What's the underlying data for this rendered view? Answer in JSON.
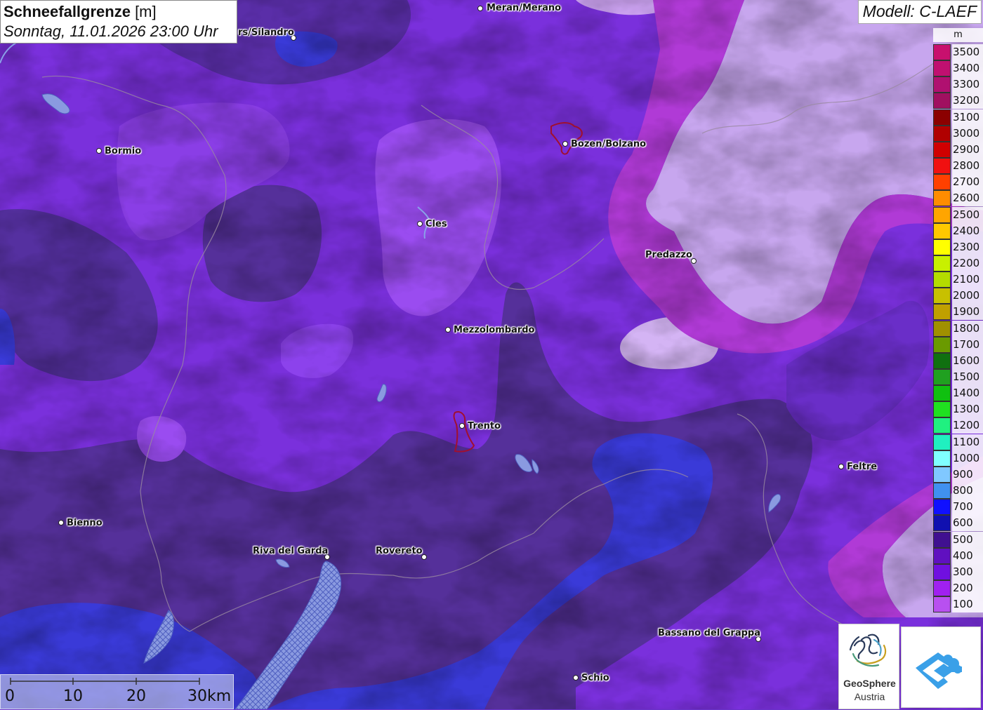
{
  "header": {
    "title_bold": "Schneefallgrenze",
    "title_unit": " [m]",
    "subtitle": "Sonntag, 11.01.2026 23:00 Uhr"
  },
  "model": "Modell: C-LAEF",
  "legend": {
    "unit": "m",
    "entries": [
      {
        "label": "3500",
        "color": "#c8106e"
      },
      {
        "label": "3400",
        "color": "#c01070"
      },
      {
        "label": "3300",
        "color": "#b01070"
      },
      {
        "label": "3200",
        "color": "#a01060"
      },
      {
        "label": "3100",
        "color": "#8b0000"
      },
      {
        "label": "3000",
        "color": "#b00000"
      },
      {
        "label": "2900",
        "color": "#d00000"
      },
      {
        "label": "2800",
        "color": "#f01010"
      },
      {
        "label": "2700",
        "color": "#ff4000"
      },
      {
        "label": "2600",
        "color": "#ff8c00"
      },
      {
        "label": "2500",
        "color": "#ffa500"
      },
      {
        "label": "2400",
        "color": "#ffc800"
      },
      {
        "label": "2300",
        "color": "#ffff00"
      },
      {
        "label": "2200",
        "color": "#c8f000"
      },
      {
        "label": "2100",
        "color": "#b4dc00"
      },
      {
        "label": "2000",
        "color": "#c8c000"
      },
      {
        "label": "1900",
        "color": "#c0a000"
      },
      {
        "label": "1800",
        "color": "#a09000"
      },
      {
        "label": "1700",
        "color": "#6a9a00"
      },
      {
        "label": "1600",
        "color": "#107010"
      },
      {
        "label": "1500",
        "color": "#20a020"
      },
      {
        "label": "1400",
        "color": "#10c010"
      },
      {
        "label": "1300",
        "color": "#20e020"
      },
      {
        "label": "1200",
        "color": "#20f080"
      },
      {
        "label": "1100",
        "color": "#20f0c0"
      },
      {
        "label": "1000",
        "color": "#80ffff"
      },
      {
        "label": "900",
        "color": "#80c8ff"
      },
      {
        "label": "800",
        "color": "#4090f0"
      },
      {
        "label": "700",
        "color": "#1010ff"
      },
      {
        "label": "600",
        "color": "#1010b0"
      },
      {
        "label": "500",
        "color": "#401090"
      },
      {
        "label": "400",
        "color": "#6010c0"
      },
      {
        "label": "300",
        "color": "#7010e0"
      },
      {
        "label": "200",
        "color": "#a020f0"
      },
      {
        "label": "100",
        "color": "#b850f0"
      }
    ]
  },
  "cities": [
    {
      "name": "Meran/Merano"
    },
    {
      "name": "rs/Silandro"
    },
    {
      "name": "Bormio"
    },
    {
      "name": "Bozen/Bolzano"
    },
    {
      "name": "Cles"
    },
    {
      "name": "Predazzo"
    },
    {
      "name": "Mezzolombardo"
    },
    {
      "name": "Trento"
    },
    {
      "name": "Feltre"
    },
    {
      "name": "Bienno"
    },
    {
      "name": "Riva del Garda"
    },
    {
      "name": "Rovereto"
    },
    {
      "name": "Bassano del Grappa"
    },
    {
      "name": "Schio"
    }
  ],
  "scalebar": {
    "labels": [
      "0",
      "10",
      "20",
      "30km"
    ]
  },
  "logos": {
    "geosphere_title": "GeoSphere",
    "geosphere_sub": "Austria"
  },
  "colors": {
    "deep_purple": "#55309a",
    "mid_purple": "#7a2ee0",
    "light_violet": "#c9a8f0",
    "magenta": "#c236d8",
    "blue": "#3a3ad8",
    "lake": "#7f8fd8"
  }
}
